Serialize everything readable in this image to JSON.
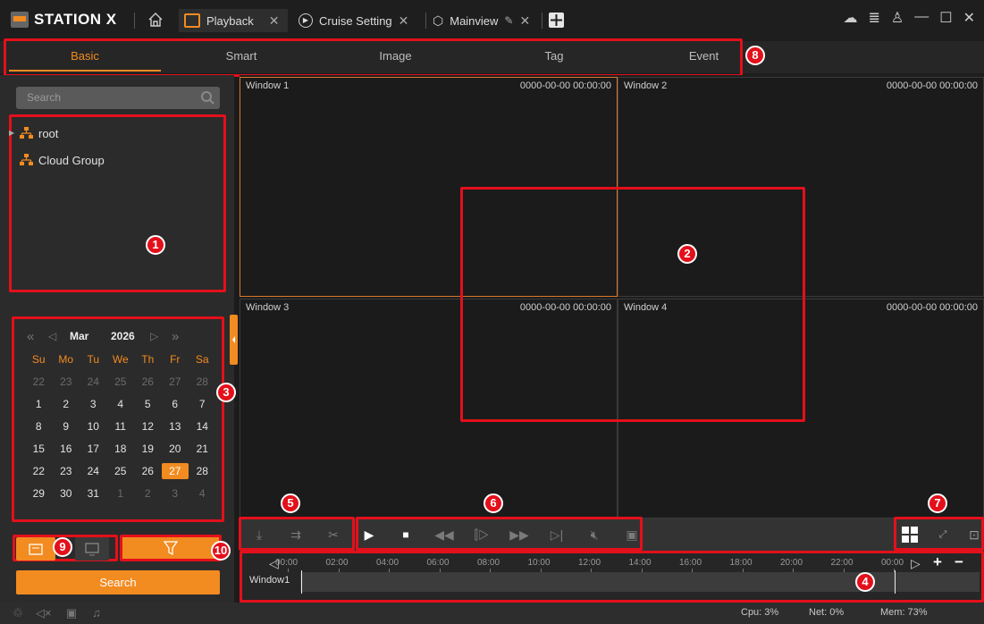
{
  "app": {
    "brand": "STATION X"
  },
  "tabs": [
    {
      "label": "Playback"
    },
    {
      "label": "Cruise Setting"
    },
    {
      "label": "Mainview"
    }
  ],
  "subtabs": [
    "Basic",
    "Smart",
    "Image",
    "Tag",
    "Event"
  ],
  "sidebar": {
    "search_placeholder": "Search",
    "tree": [
      {
        "label": "root"
      },
      {
        "label": "Cloud Group"
      }
    ]
  },
  "calendar": {
    "month": "Mar",
    "year": "2026",
    "weekdays": [
      "Su",
      "Mo",
      "Tu",
      "We",
      "Th",
      "Fr",
      "Sa"
    ],
    "weeks": [
      [
        "22",
        "23",
        "24",
        "25",
        "26",
        "27",
        "28"
      ],
      [
        "1",
        "2",
        "3",
        "4",
        "5",
        "6",
        "7"
      ],
      [
        "8",
        "9",
        "10",
        "11",
        "12",
        "13",
        "14"
      ],
      [
        "15",
        "16",
        "17",
        "18",
        "19",
        "20",
        "21"
      ],
      [
        "22",
        "23",
        "24",
        "25",
        "26",
        "27",
        "28"
      ],
      [
        "29",
        "30",
        "31",
        "1",
        "2",
        "3",
        "4"
      ]
    ],
    "selected": "27"
  },
  "search_button": "Search",
  "windows": [
    {
      "title": "Window 1",
      "datetime": "0000-00-00 00:00:00"
    },
    {
      "title": "Window 2",
      "datetime": "0000-00-00 00:00:00"
    },
    {
      "title": "Window 3",
      "datetime": "0000-00-00 00:00:00"
    },
    {
      "title": "Window 4",
      "datetime": "0000-00-00 00:00:00"
    }
  ],
  "timeline": {
    "ticks": [
      "00:00",
      "02:00",
      "04:00",
      "06:00",
      "08:00",
      "10:00",
      "12:00",
      "14:00",
      "16:00",
      "18:00",
      "20:00",
      "22:00",
      "00:00"
    ],
    "track_label": "Window1"
  },
  "annotations": [
    "1",
    "2",
    "3",
    "4",
    "5",
    "6",
    "7",
    "8",
    "9",
    "10"
  ],
  "status": {
    "cpu": "Cpu: 3%",
    "net": "Net: 0%",
    "mem": "Mem: 73%"
  },
  "colors": {
    "accent": "#f28b20",
    "highlight": "#e3101b"
  }
}
